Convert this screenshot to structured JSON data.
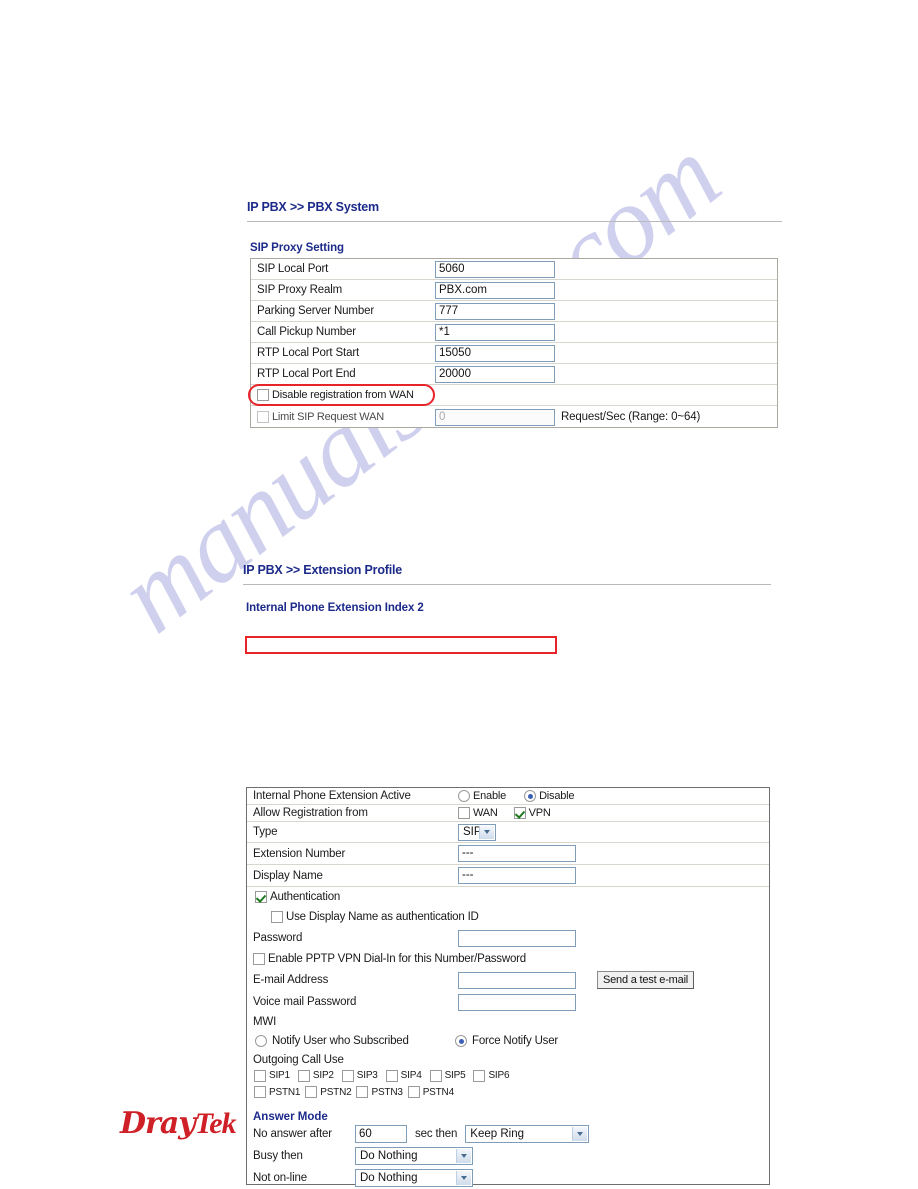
{
  "watermark": {
    "text": "manualshive.com"
  },
  "brand": {
    "name_bold": "Dray",
    "name_light": "Tek"
  },
  "pbx_system": {
    "breadcrumb": "IP PBX >> PBX System",
    "section_title": "SIP Proxy Setting",
    "rows": [
      {
        "label": "SIP Local Port",
        "value": "5060"
      },
      {
        "label": "SIP Proxy Realm",
        "value": "PBX.com"
      },
      {
        "label": "Parking Server Number",
        "value": "777"
      },
      {
        "label": "Call Pickup Number",
        "value": "*1"
      },
      {
        "label": "RTP Local Port Start",
        "value": "15050"
      },
      {
        "label": "RTP Local Port End",
        "value": "20000"
      }
    ],
    "disable_reg_wan": {
      "label": "Disable registration from WAN",
      "checked": false
    },
    "limit_sip": {
      "label": "Limit SIP Request WAN",
      "checked": false,
      "value": "0",
      "suffix": "Request/Sec (Range: 0~64)"
    }
  },
  "extension_profile": {
    "breadcrumb": "IP PBX >> Extension Profile",
    "section_title": "Internal Phone Extension Index 2",
    "active": {
      "label": "Internal Phone Extension Active",
      "enable_label": "Enable",
      "disable_label": "Disable",
      "selected": "Disable"
    },
    "allow_registration": {
      "label": "Allow Registration from",
      "wan_label": "WAN",
      "wan_checked": false,
      "vpn_label": "VPN",
      "vpn_checked": true
    },
    "type": {
      "label": "Type",
      "value": "SIP"
    },
    "extension_number": {
      "label": "Extension Number",
      "value": "---"
    },
    "display_name": {
      "label": "Display Name",
      "value": "---"
    },
    "authentication": {
      "label": "Authentication",
      "checked": true
    },
    "use_display_name": {
      "label": "Use Display Name as authentication ID",
      "checked": false
    },
    "password": {
      "label": "Password",
      "value": ""
    },
    "pptp": {
      "label": "Enable PPTP VPN Dial-In for this Number/Password",
      "checked": false
    },
    "email": {
      "label": "E-mail Address",
      "value": "",
      "button": "Send a test e-mail"
    },
    "voicemail_password": {
      "label": "Voice mail Password",
      "value": ""
    },
    "mwi": {
      "label": "MWI",
      "notify_subscribed_label": "Notify User who Subscribed",
      "force_notify_label": "Force Notify User",
      "selected": "Force Notify User"
    },
    "outgoing_call_use": {
      "label": "Outgoing Call Use",
      "sip": [
        {
          "label": "SIP1",
          "checked": false
        },
        {
          "label": "SIP2",
          "checked": false
        },
        {
          "label": "SIP3",
          "checked": false
        },
        {
          "label": "SIP4",
          "checked": false
        },
        {
          "label": "SIP5",
          "checked": false
        },
        {
          "label": "SIP6",
          "checked": false
        }
      ],
      "pstn": [
        {
          "label": "PSTN1",
          "checked": false
        },
        {
          "label": "PSTN2",
          "checked": false
        },
        {
          "label": "PSTN3",
          "checked": false
        },
        {
          "label": "PSTN4",
          "checked": false
        }
      ]
    },
    "answer_mode": {
      "heading": "Answer Mode",
      "no_answer_label": "No answer after",
      "no_answer_value": "60",
      "sec_then_label": "sec then",
      "no_answer_action": "Keep Ring",
      "busy_label": "Busy then",
      "busy_action": "Do Nothing",
      "offline_label": "Not on-line",
      "offline_action": "Do Nothing"
    }
  }
}
